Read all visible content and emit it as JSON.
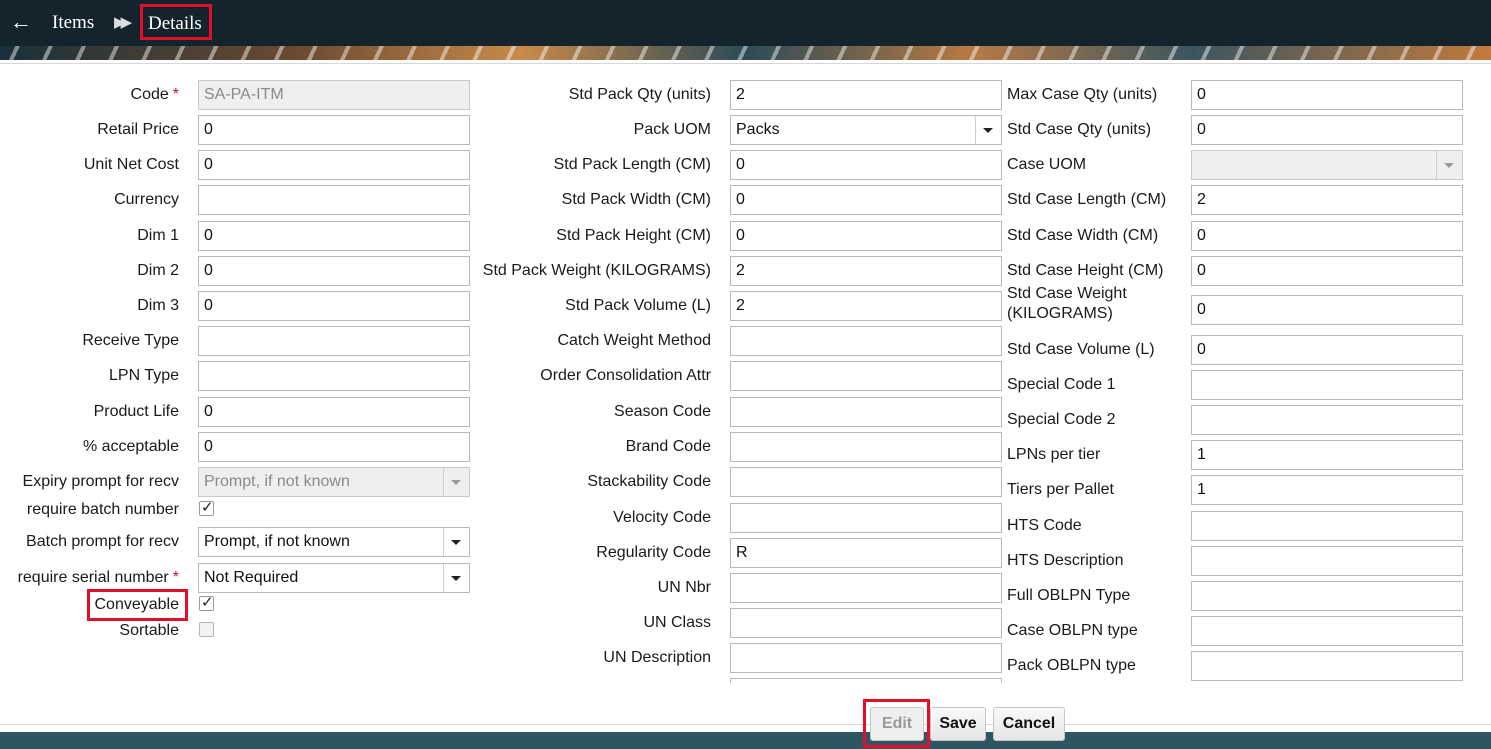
{
  "header": {
    "back_icon": "arrow-left-icon",
    "breadcrumb": [
      "Items",
      "Details"
    ],
    "separator_icon": "double-chevron-right-icon"
  },
  "col1": [
    {
      "label": "Code",
      "required": "*",
      "type": "text",
      "value": "SA-PA-ITM",
      "disabled": true
    },
    {
      "label": "Retail Price",
      "type": "text",
      "value": "0"
    },
    {
      "label": "Unit Net Cost",
      "type": "text",
      "value": "0"
    },
    {
      "label": "Currency",
      "type": "text",
      "value": ""
    },
    {
      "label": "Dim 1",
      "type": "text",
      "value": "0"
    },
    {
      "label": "Dim 2",
      "type": "text",
      "value": "0"
    },
    {
      "label": "Dim 3",
      "type": "text",
      "value": "0"
    },
    {
      "label": "Receive Type",
      "type": "text",
      "value": ""
    },
    {
      "label": "LPN Type",
      "type": "text",
      "value": ""
    },
    {
      "label": "Product Life",
      "type": "text",
      "value": "0"
    },
    {
      "label": "% acceptable",
      "type": "text",
      "value": "0"
    },
    {
      "label": "Expiry prompt for recv",
      "type": "select",
      "value": "Prompt, if not known",
      "disabled": true
    },
    {
      "label": "require batch number",
      "type": "checkbox",
      "checked": true
    },
    {
      "label": "Batch prompt for recv",
      "type": "select",
      "value": "Prompt, if not known"
    },
    {
      "label": "require serial number",
      "required": "*",
      "type": "select",
      "value": "Not Required"
    },
    {
      "label": "Conveyable",
      "type": "checkbox",
      "checked": true
    },
    {
      "label": "Sortable",
      "type": "checkbox",
      "checked": false
    }
  ],
  "col2": [
    {
      "label": "Std Pack Qty (units)",
      "type": "text",
      "value": "2"
    },
    {
      "label": "Pack UOM",
      "type": "select",
      "value": "Packs"
    },
    {
      "label": "Std Pack Length (CM)",
      "type": "text",
      "value": "0"
    },
    {
      "label": "Std Pack Width (CM)",
      "type": "text",
      "value": "0"
    },
    {
      "label": "Std Pack Height (CM)",
      "type": "text",
      "value": "0"
    },
    {
      "label": "Std Pack Weight (KILOGRAMS)",
      "type": "text",
      "value": "2"
    },
    {
      "label": "Std Pack Volume (L)",
      "type": "text",
      "value": "2"
    },
    {
      "label": "Catch Weight Method",
      "type": "text",
      "value": ""
    },
    {
      "label": "Order Consolidation Attr",
      "type": "text",
      "value": ""
    },
    {
      "label": "Season Code",
      "type": "text",
      "value": ""
    },
    {
      "label": "Brand Code",
      "type": "text",
      "value": ""
    },
    {
      "label": "Stackability Code",
      "type": "text",
      "value": ""
    },
    {
      "label": "Velocity Code",
      "type": "text",
      "value": ""
    },
    {
      "label": "Regularity Code",
      "type": "text",
      "value": "R"
    },
    {
      "label": "UN Nbr",
      "type": "text",
      "value": ""
    },
    {
      "label": "UN Class",
      "type": "text",
      "value": ""
    },
    {
      "label": "UN Description",
      "type": "text",
      "value": ""
    }
  ],
  "col3": [
    {
      "label": "Max Case Qty (units)",
      "type": "text",
      "value": "0"
    },
    {
      "label": "Std Case Qty (units)",
      "type": "text",
      "value": "0"
    },
    {
      "label": "Case UOM",
      "type": "select",
      "value": "",
      "disabled": true
    },
    {
      "label": "Std Case Length (CM)",
      "type": "text",
      "value": "2"
    },
    {
      "label": "Std Case Width (CM)",
      "type": "text",
      "value": "0"
    },
    {
      "label": "Std Case Height (CM)",
      "type": "text",
      "value": "0"
    },
    {
      "label": "Std Case Weight (KILOGRAMS)",
      "type": "text",
      "value": "0"
    },
    {
      "label": "Std Case Volume (L)",
      "type": "text",
      "value": "0"
    },
    {
      "label": "Special Code 1",
      "type": "text",
      "value": ""
    },
    {
      "label": "Special Code 2",
      "type": "text",
      "value": ""
    },
    {
      "label": "LPNs per tier",
      "type": "text",
      "value": "1"
    },
    {
      "label": "Tiers per Pallet",
      "type": "text",
      "value": "1"
    },
    {
      "label": "HTS Code",
      "type": "text",
      "value": ""
    },
    {
      "label": "HTS Description",
      "type": "text",
      "value": ""
    },
    {
      "label": "Full OBLPN Type",
      "type": "text",
      "value": ""
    },
    {
      "label": "Case OBLPN type",
      "type": "text",
      "value": ""
    },
    {
      "label": "Pack OBLPN type",
      "type": "text",
      "value": ""
    }
  ],
  "footer": {
    "edit_label": "Edit",
    "save_label": "Save",
    "cancel_label": "Cancel"
  }
}
